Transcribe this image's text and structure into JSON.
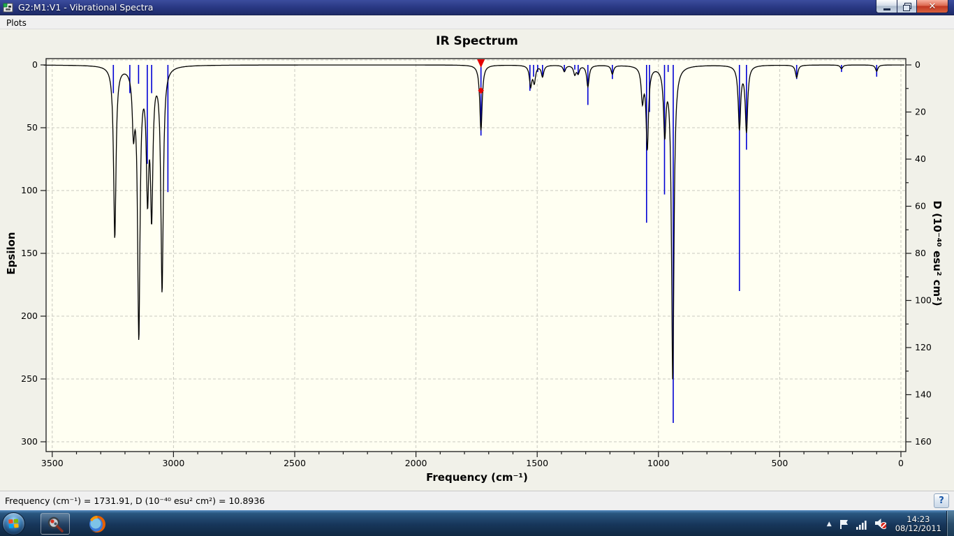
{
  "window": {
    "title": "G2:M1:V1 - Vibrational Spectra",
    "controls": {
      "minimize": "minimize",
      "restore": "restore",
      "close": "close"
    }
  },
  "menu_bar": {
    "items": [
      {
        "label": "Plots"
      }
    ]
  },
  "chart_data": {
    "type": "line",
    "title": "IR Spectrum",
    "x_axis": {
      "label": "Frequency (cm⁻¹)",
      "min": 0,
      "max": 3500,
      "reversed": true,
      "major_ticks": [
        3500,
        3000,
        2500,
        2000,
        1500,
        1000,
        500,
        0
      ],
      "minor_step": 100
    },
    "y_axis_left": {
      "label": "Epsilon",
      "min": 0,
      "max": 300,
      "inverted": true,
      "major_ticks": [
        0,
        50,
        100,
        150,
        200,
        250,
        300
      ]
    },
    "y_axis_right": {
      "label": "D (10⁻⁴⁰ esu² cm²)",
      "min": 0,
      "max": 160,
      "inverted": true,
      "major_ticks": [
        0,
        20,
        40,
        60,
        80,
        100,
        120,
        140,
        160
      ],
      "minor_step": 10
    },
    "grid": {
      "style": "dashed",
      "color": "#c9c9c0"
    },
    "canvas_bg": "#fffff2",
    "outer_bg": "#f1f1e9",
    "series": [
      {
        "name": "Epsilon spectrum",
        "type": "lorentzian_sum",
        "color": "#000000",
        "hwhm_cm": 6,
        "peaks": [
          [
            3242,
            137
          ],
          [
            3165,
            45
          ],
          [
            3143,
            212
          ],
          [
            3107,
            95
          ],
          [
            3090,
            111
          ],
          [
            3047,
            178
          ],
          [
            1731.91,
            52
          ],
          [
            1527,
            16
          ],
          [
            1512,
            13
          ],
          [
            1478,
            9
          ],
          [
            1388,
            5
          ],
          [
            1345,
            7
          ],
          [
            1331,
            6
          ],
          [
            1291,
            17
          ],
          [
            1190,
            7
          ],
          [
            1066,
            26
          ],
          [
            1046,
            65
          ],
          [
            974,
            51
          ],
          [
            941,
            250
          ],
          [
            666,
            50
          ],
          [
            637,
            52
          ],
          [
            430,
            10
          ],
          [
            245,
            3
          ],
          [
            100,
            5
          ]
        ]
      },
      {
        "name": "D intensity lines",
        "type": "vertical_lines",
        "color": "#0000d4",
        "lines": [
          [
            3248,
            12
          ],
          [
            3180,
            12
          ],
          [
            3144,
            8
          ],
          [
            3108,
            42
          ],
          [
            3090,
            12
          ],
          [
            3023,
            54
          ],
          [
            1731.91,
            30
          ],
          [
            1530,
            11
          ],
          [
            1515,
            5
          ],
          [
            1498,
            3
          ],
          [
            1478,
            5
          ],
          [
            1388,
            3
          ],
          [
            1345,
            2
          ],
          [
            1331,
            4
          ],
          [
            1291,
            17
          ],
          [
            1190,
            6
          ],
          [
            1049,
            67
          ],
          [
            1037,
            20
          ],
          [
            975,
            55
          ],
          [
            960,
            3
          ],
          [
            939,
            152
          ],
          [
            666,
            96
          ],
          [
            637,
            36
          ],
          [
            430,
            6
          ],
          [
            245,
            3
          ],
          [
            100,
            5
          ]
        ]
      }
    ],
    "cursor": {
      "frequency": 1731.91,
      "d": 10.8936,
      "marker_color": "#e40000"
    }
  },
  "status_bar": {
    "text": "Frequency (cm⁻¹) = 1731.91, D (10⁻⁴⁰ esu² cm²) = 10.8936",
    "help_label": "?"
  },
  "taskbar": {
    "start_label": "Start",
    "apps": [
      {
        "name": "Vibrational Spectra application"
      },
      {
        "name": "Firefox"
      }
    ],
    "tray": {
      "hidden_icons": "▲",
      "time": "14:23",
      "date": "08/12/2011"
    }
  }
}
